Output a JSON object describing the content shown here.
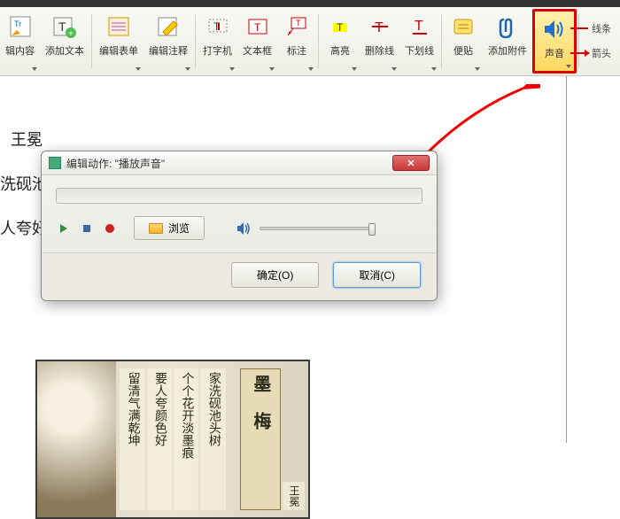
{
  "toolbar": {
    "edit_content": "辑内容",
    "add_text": "添加文本",
    "edit_form": "编辑表单",
    "edit_annot": "编辑注释",
    "typewriter": "打字机",
    "textbox": "文本框",
    "callout": "标注",
    "highlight": "高亮",
    "strikethrough": "删除线",
    "underline": "下划线",
    "note": "便贴",
    "attachment": "添加附件",
    "sound": "声音"
  },
  "right_panel": {
    "line": "线条",
    "arrow": "箭头"
  },
  "doc": {
    "t1": "王冕",
    "t2": "洗砚池",
    "t3": "人夸好"
  },
  "dialog": {
    "title": "编辑动作: \"播放声音\"",
    "browse": "浏览",
    "ok": "确定(O)",
    "cancel": "取消(C)"
  },
  "book": {
    "c1": "留清气满乾坤",
    "c2": "要人夸颜色好",
    "c3": "个个花开淡墨痕",
    "c4": "家洗砚池头树",
    "title": "墨 梅",
    "author": "王冕"
  }
}
